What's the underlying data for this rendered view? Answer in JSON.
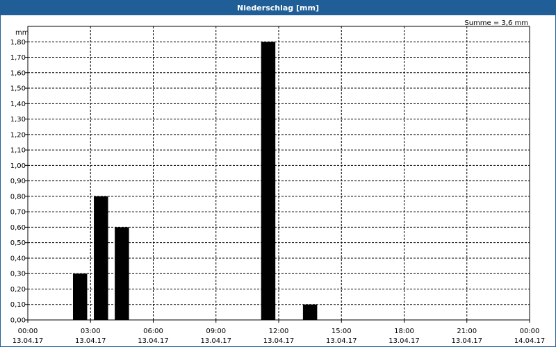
{
  "window": {
    "title": "Niederschlag [mm]"
  },
  "chart_data": {
    "type": "bar",
    "title": "Niederschlag [mm]",
    "ylabel": "mm",
    "annotation": "Summe = 3,6 mm",
    "ylim": [
      0,
      1.9
    ],
    "y_ticks": [
      "0,00",
      "0,10",
      "0,20",
      "0,30",
      "0,40",
      "0,50",
      "0,60",
      "0,70",
      "0,80",
      "0,90",
      "1,00",
      "1,10",
      "1,20",
      "1,30",
      "1,40",
      "1,50",
      "1,60",
      "1,70",
      "1,80"
    ],
    "x_ticks": [
      {
        "time": "00:00",
        "date": "13.04.17"
      },
      {
        "time": "03:00",
        "date": "13.04.17"
      },
      {
        "time": "06:00",
        "date": "13.04.17"
      },
      {
        "time": "09:00",
        "date": "13.04.17"
      },
      {
        "time": "12:00",
        "date": "13.04.17"
      },
      {
        "time": "15:00",
        "date": "13.04.17"
      },
      {
        "time": "18:00",
        "date": "13.04.17"
      },
      {
        "time": "21:00",
        "date": "13.04.17"
      },
      {
        "time": "00:00",
        "date": "14.04.17"
      }
    ],
    "grid": true,
    "bar_color": "#000000",
    "bars": [
      {
        "hour": 2.5,
        "value": 0.3
      },
      {
        "hour": 3.5,
        "value": 0.8
      },
      {
        "hour": 4.5,
        "value": 0.6
      },
      {
        "hour": 11.5,
        "value": 1.8
      },
      {
        "hour": 13.5,
        "value": 0.1
      }
    ]
  }
}
